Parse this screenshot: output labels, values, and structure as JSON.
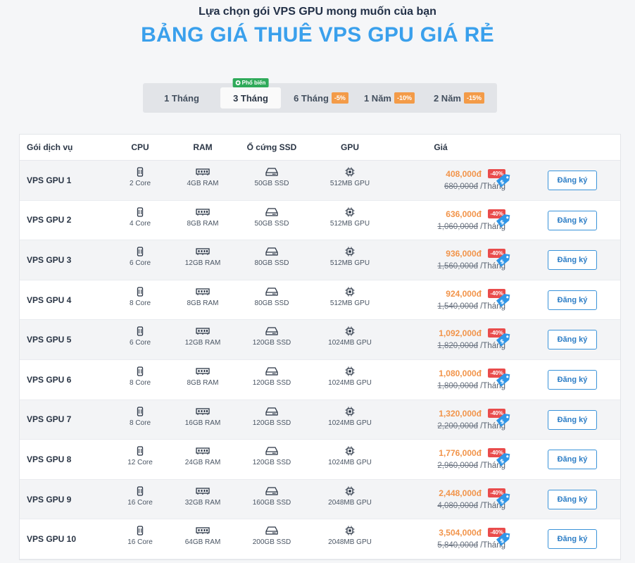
{
  "header": {
    "subtitle": "Lựa chọn gói VPS GPU mong muốn của bạn",
    "title": "BẢNG GIÁ THUÊ VPS GPU GIÁ RẺ"
  },
  "tabs": [
    {
      "label": "1 Tháng",
      "discount": ""
    },
    {
      "label": "3 Tháng",
      "discount": "",
      "badge": "Phổ biến",
      "active": true
    },
    {
      "label": "6 Tháng",
      "discount": "-5%"
    },
    {
      "label": "1 Năm",
      "discount": "-10%"
    },
    {
      "label": "2 Năm",
      "discount": "-15%"
    }
  ],
  "columns": {
    "package": "Gói dịch vụ",
    "cpu": "CPU",
    "ram": "RAM",
    "ssd": "Ổ cứng SSD",
    "gpu": "GPU",
    "price": "Giá"
  },
  "per_month": "/Tháng",
  "register_label": "Đăng ký",
  "colors": {
    "accent": "#3aa0ec",
    "price": "#f2944a",
    "discount": "#e94c4c",
    "popular": "#2faa5a"
  },
  "plans": [
    {
      "name": "VPS GPU 1",
      "cpu": "2 Core",
      "ram": "4GB RAM",
      "ssd": "50GB SSD",
      "gpu": "512MB GPU",
      "price": "408,000đ",
      "discount": "-40%",
      "old_price": "680,000đ"
    },
    {
      "name": "VPS GPU 2",
      "cpu": "4 Core",
      "ram": "8GB RAM",
      "ssd": "50GB SSD",
      "gpu": "512MB GPU",
      "price": "636,000đ",
      "discount": "-40%",
      "old_price": "1,060,000đ"
    },
    {
      "name": "VPS GPU 3",
      "cpu": "6 Core",
      "ram": "12GB RAM",
      "ssd": "80GB SSD",
      "gpu": "512MB GPU",
      "price": "936,000đ",
      "discount": "-40%",
      "old_price": "1,560,000đ"
    },
    {
      "name": "VPS GPU 4",
      "cpu": "8 Core",
      "ram": "8GB RAM",
      "ssd": "80GB SSD",
      "gpu": "512MB GPU",
      "price": "924,000đ",
      "discount": "-40%",
      "old_price": "1,540,000đ"
    },
    {
      "name": "VPS GPU 5",
      "cpu": "6 Core",
      "ram": "12GB RAM",
      "ssd": "120GB SSD",
      "gpu": "1024MB GPU",
      "price": "1,092,000đ",
      "discount": "-40%",
      "old_price": "1,820,000đ"
    },
    {
      "name": "VPS GPU 6",
      "cpu": "8 Core",
      "ram": "8GB RAM",
      "ssd": "120GB SSD",
      "gpu": "1024MB GPU",
      "price": "1,080,000đ",
      "discount": "-40%",
      "old_price": "1,800,000đ"
    },
    {
      "name": "VPS GPU 7",
      "cpu": "8 Core",
      "ram": "16GB RAM",
      "ssd": "120GB SSD",
      "gpu": "1024MB GPU",
      "price": "1,320,000đ",
      "discount": "-40%",
      "old_price": "2,200,000đ"
    },
    {
      "name": "VPS GPU 8",
      "cpu": "12 Core",
      "ram": "24GB RAM",
      "ssd": "120GB SSD",
      "gpu": "1024MB GPU",
      "price": "1,776,000đ",
      "discount": "-40%",
      "old_price": "2,960,000đ"
    },
    {
      "name": "VPS GPU 9",
      "cpu": "16 Core",
      "ram": "32GB RAM",
      "ssd": "160GB SSD",
      "gpu": "2048MB GPU",
      "price": "2,448,000đ",
      "discount": "-40%",
      "old_price": "4,080,000đ"
    },
    {
      "name": "VPS GPU 10",
      "cpu": "16 Core",
      "ram": "64GB RAM",
      "ssd": "200GB SSD",
      "gpu": "2048MB GPU",
      "price": "3,504,000đ",
      "discount": "-40%",
      "old_price": "5,840,000đ"
    }
  ]
}
